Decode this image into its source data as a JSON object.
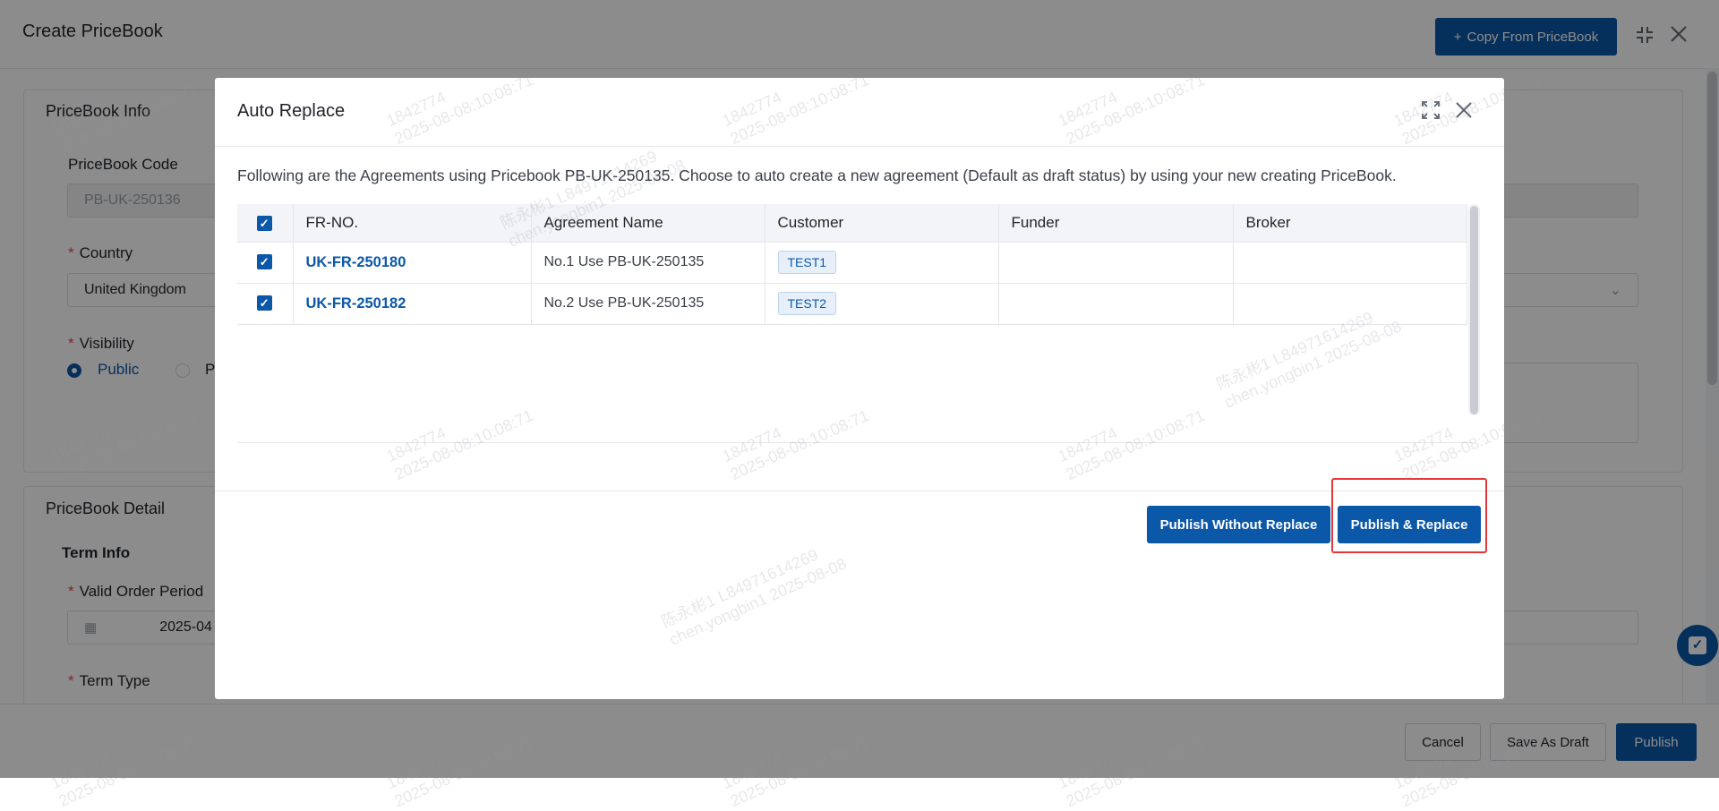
{
  "page": {
    "title": "Create PriceBook",
    "copy_button": "Copy From PriceBook",
    "copy_icon": "plus-icon",
    "collapse_icon": "compress-icon",
    "close_icon": "close-icon"
  },
  "pricebook_info": {
    "title": "PriceBook Info",
    "code_label": "PriceBook Code",
    "code_value": "PB-UK-250136",
    "country_label": "Country",
    "country_value": "United Kingdom",
    "visibility_label": "Visibility",
    "visibility_public": "Public",
    "visibility_private": "P"
  },
  "pricebook_detail": {
    "title": "PriceBook Detail",
    "term_info": "Term Info",
    "valid_order_label": "Valid Order Period",
    "valid_order_value": "2025-04",
    "term_type_label": "Term Type"
  },
  "footer": {
    "cancel": "Cancel",
    "save_draft": "Save As Draft",
    "publish": "Publish"
  },
  "modal": {
    "title": "Auto Replace",
    "description": "Following are the Agreements using Pricebook PB-UK-250135. Choose to auto create a new agreement (Default as draft status) by using your new creating PriceBook.",
    "columns": [
      "FR-NO.",
      "Agreement Name",
      "Customer",
      "Funder",
      "Broker"
    ],
    "rows": [
      {
        "fr_no": "UK-FR-250180",
        "agreement_name": "No.1 Use PB-UK-250135",
        "customer": "TEST1",
        "funder": "",
        "broker": "",
        "checked": true
      },
      {
        "fr_no": "UK-FR-250182",
        "agreement_name": "No.2 Use PB-UK-250135",
        "customer": "TEST2",
        "funder": "",
        "broker": "",
        "checked": true
      }
    ],
    "publish_without_replace": "Publish Without Replace",
    "publish_and_replace": "Publish & Replace"
  },
  "watermark": {
    "line1": "1842774",
    "line2": "2025-08-08:10:08:71",
    "line3": "陈永彬1 L84971614269",
    "line4": "chen.yongbin1 2025-08-08"
  },
  "colors": {
    "primary": "#0b58a8",
    "highlight": "#e5373a",
    "required": "#e5484d"
  }
}
